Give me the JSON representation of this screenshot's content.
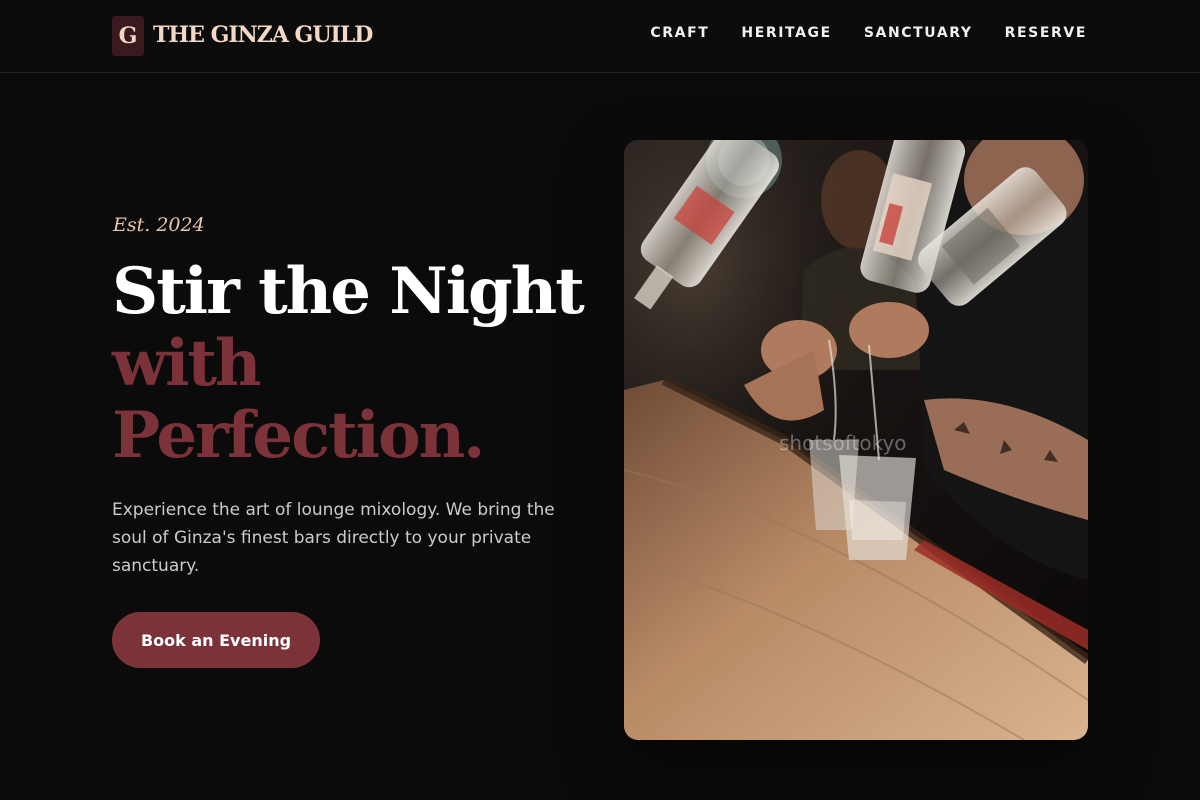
{
  "brand": {
    "mark": "G",
    "name": "THE GINZA GUILD"
  },
  "nav": {
    "items": [
      "CRAFT",
      "HERITAGE",
      "SANCTUARY",
      "RESERVE"
    ]
  },
  "hero": {
    "eyebrow": "Est. 2024",
    "headline_line1": "Stir the Night",
    "headline_line2": "with",
    "headline_line3": "Perfection.",
    "body": "Experience the art of lounge mixology. We bring the soul of Ginza's finest bars directly to your private sanctuary.",
    "cta_label": "Book an Evening",
    "photo_watermark": "shotsoftokyo"
  },
  "colors": {
    "background": "#0c0b0b",
    "accent": "#7b3239",
    "brand_text": "#f3d8c6",
    "eyebrow": "#e9c7ae"
  }
}
